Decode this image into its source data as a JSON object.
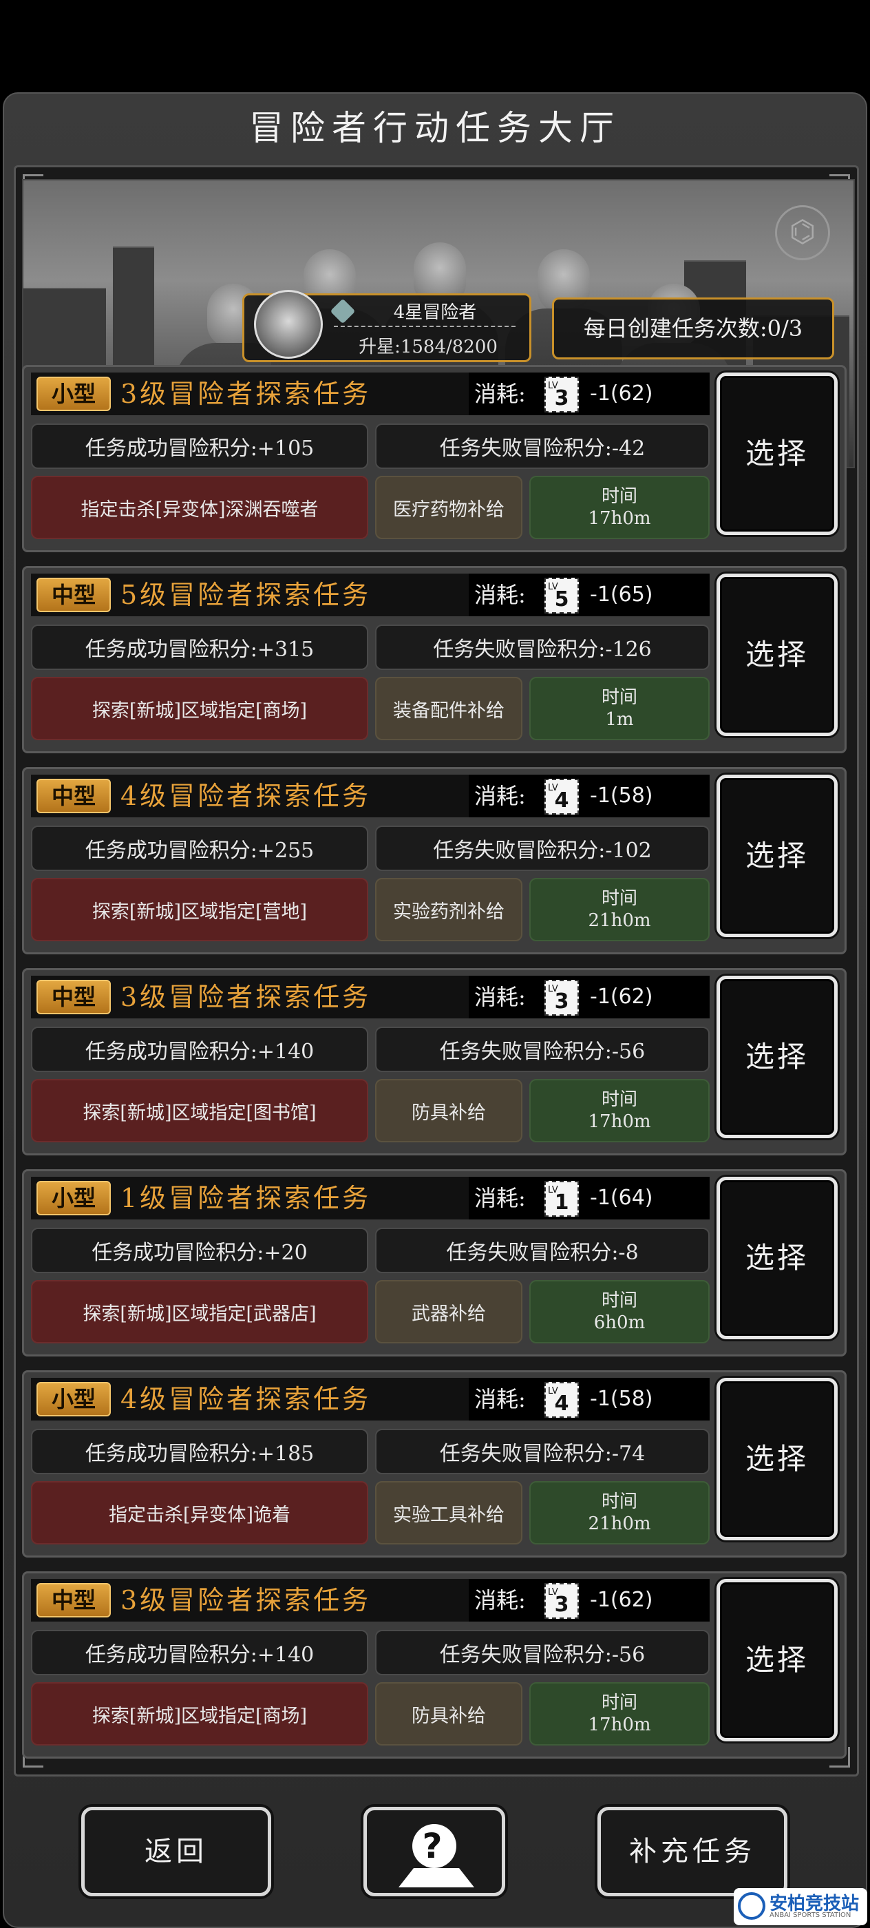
{
  "header": {
    "title": "冒险者行动任务大厅"
  },
  "profile": {
    "rank": "4星冒险者",
    "star_progress": "升星:1584/8200",
    "daily_tasks": "每日创建任务次数:0/3"
  },
  "missions": [
    {
      "size": "小型",
      "name": "3级冒险者探索任务",
      "cost_label": "消耗:",
      "cost_lv": "3",
      "cost_lv_tag": "LV",
      "cost_value": "-1(62)",
      "success": "任务成功冒险积分:+105",
      "failure": "任务失败冒险积分:-42",
      "target": "指定击杀[异变体]深渊吞噬者",
      "supply": "医疗药物补给",
      "time_label": "时间",
      "time_value": "17h0m",
      "select": "选择"
    },
    {
      "size": "中型",
      "name": "5级冒险者探索任务",
      "cost_label": "消耗:",
      "cost_lv": "5",
      "cost_lv_tag": "LV",
      "cost_value": "-1(65)",
      "success": "任务成功冒险积分:+315",
      "failure": "任务失败冒险积分:-126",
      "target": "探索[新城]区域指定[商场]",
      "supply": "装备配件补给",
      "time_label": "时间",
      "time_value": "1m",
      "select": "选择"
    },
    {
      "size": "中型",
      "name": "4级冒险者探索任务",
      "cost_label": "消耗:",
      "cost_lv": "4",
      "cost_lv_tag": "LV",
      "cost_value": "-1(58)",
      "success": "任务成功冒险积分:+255",
      "failure": "任务失败冒险积分:-102",
      "target": "探索[新城]区域指定[营地]",
      "supply": "实验药剂补给",
      "time_label": "时间",
      "time_value": "21h0m",
      "select": "选择"
    },
    {
      "size": "中型",
      "name": "3级冒险者探索任务",
      "cost_label": "消耗:",
      "cost_lv": "3",
      "cost_lv_tag": "LV",
      "cost_value": "-1(62)",
      "success": "任务成功冒险积分:+140",
      "failure": "任务失败冒险积分:-56",
      "target": "探索[新城]区域指定[图书馆]",
      "supply": "防具补给",
      "time_label": "时间",
      "time_value": "17h0m",
      "select": "选择"
    },
    {
      "size": "小型",
      "name": "1级冒险者探索任务",
      "cost_label": "消耗:",
      "cost_lv": "1",
      "cost_lv_tag": "LV",
      "cost_value": "-1(64)",
      "success": "任务成功冒险积分:+20",
      "failure": "任务失败冒险积分:-8",
      "target": "探索[新城]区域指定[武器店]",
      "supply": "武器补给",
      "time_label": "时间",
      "time_value": "6h0m",
      "select": "选择"
    },
    {
      "size": "小型",
      "name": "4级冒险者探索任务",
      "cost_label": "消耗:",
      "cost_lv": "4",
      "cost_lv_tag": "LV",
      "cost_value": "-1(58)",
      "success": "任务成功冒险积分:+185",
      "failure": "任务失败冒险积分:-74",
      "target": "指定击杀[异变体]诡着",
      "supply": "实验工具补给",
      "time_label": "时间",
      "time_value": "21h0m",
      "select": "选择"
    },
    {
      "size": "中型",
      "name": "3级冒险者探索任务",
      "cost_label": "消耗:",
      "cost_lv": "3",
      "cost_lv_tag": "LV",
      "cost_value": "-1(62)",
      "success": "任务成功冒险积分:+140",
      "failure": "任务失败冒险积分:-56",
      "target": "探索[新城]区域指定[商场]",
      "supply": "防具补给",
      "time_label": "时间",
      "time_value": "17h0m",
      "select": "选择"
    }
  ],
  "footer": {
    "back": "返回",
    "help_icon": "question-map-icon",
    "replenish": "补充任务"
  },
  "watermark": {
    "main": "安柏竞技站",
    "sub": "ANBAI SPORTS STATION"
  },
  "colors": {
    "accent": "#e8a23a",
    "badge": "#d1932f",
    "target_bg": "#5a2020",
    "supply_bg": "#4a4234",
    "time_bg": "#2e4a2a"
  }
}
